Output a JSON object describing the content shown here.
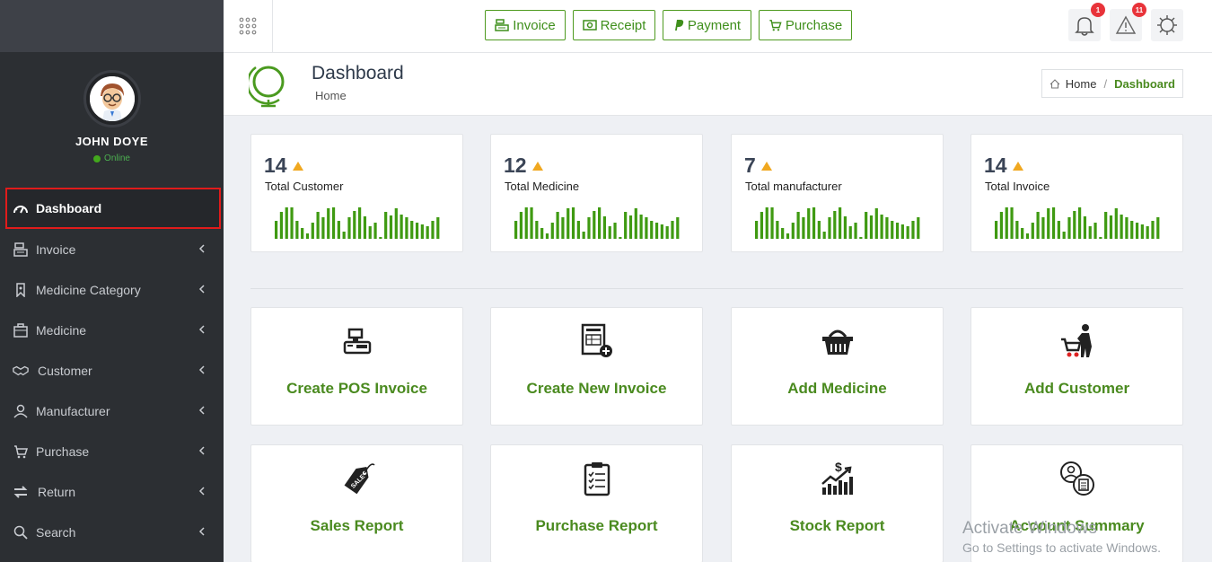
{
  "user": {
    "name": "JOHN DOYE",
    "status": "Online"
  },
  "nav": [
    {
      "label": "Dashboard",
      "icon": "dashboard-gauge-icon",
      "active": true
    },
    {
      "label": "Invoice",
      "icon": "cash-register-icon"
    },
    {
      "label": "Medicine Category",
      "icon": "bookmark-tag-icon"
    },
    {
      "label": "Medicine",
      "icon": "briefcase-icon"
    },
    {
      "label": "Customer",
      "icon": "handshake-icon"
    },
    {
      "label": "Manufacturer",
      "icon": "user-icon"
    },
    {
      "label": "Purchase",
      "icon": "cart-icon"
    },
    {
      "label": "Return",
      "icon": "exchange-icon"
    },
    {
      "label": "Search",
      "icon": "search-icon"
    }
  ],
  "topbar": {
    "quick_buttons": [
      {
        "label": "Invoice",
        "icon": "cash-register-icon"
      },
      {
        "label": "Receipt",
        "icon": "money-bill-icon"
      },
      {
        "label": "Payment",
        "icon": "paypal-icon"
      },
      {
        "label": "Purchase",
        "icon": "cart-icon"
      }
    ],
    "notifications_count": "1",
    "alerts_count": "11"
  },
  "header": {
    "title": "Dashboard",
    "subtitle": "Home",
    "breadcrumb": {
      "home": "Home",
      "current": "Dashboard"
    }
  },
  "stats": [
    {
      "value": "14",
      "label": "Total Customer"
    },
    {
      "value": "12",
      "label": "Total Medicine"
    },
    {
      "value": "7",
      "label": "Total manufacturer"
    },
    {
      "value": "14",
      "label": "Total Invoice"
    }
  ],
  "sparkline": [
    20,
    30,
    35,
    35,
    20,
    12,
    6,
    18,
    30,
    24,
    34,
    35,
    20,
    8,
    24,
    31,
    35,
    25,
    14,
    18,
    2,
    30,
    26,
    34,
    27,
    24,
    20,
    18,
    16,
    14,
    20,
    24
  ],
  "actions": [
    {
      "label": "Create POS Invoice",
      "icon": "pos-register-icon"
    },
    {
      "label": "Create New Invoice",
      "icon": "invoice-add-icon"
    },
    {
      "label": "Add Medicine",
      "icon": "basket-icon"
    },
    {
      "label": "Add Customer",
      "icon": "shopper-cart-icon"
    },
    {
      "label": "Sales Report",
      "icon": "sale-tag-icon"
    },
    {
      "label": "Purchase Report",
      "icon": "clipboard-checklist-icon"
    },
    {
      "label": "Stock Report",
      "icon": "stock-chart-icon"
    },
    {
      "label": "Account Summary",
      "icon": "account-document-icon"
    }
  ],
  "watermark": {
    "line1": "Activate Windows",
    "line2": "Go to Settings to activate Windows."
  },
  "colors": {
    "accent_green": "#4a8a1f",
    "sidebar_bg": "#2c2f33",
    "badge_red": "#e8333a",
    "active_border": "#e01b1b"
  }
}
